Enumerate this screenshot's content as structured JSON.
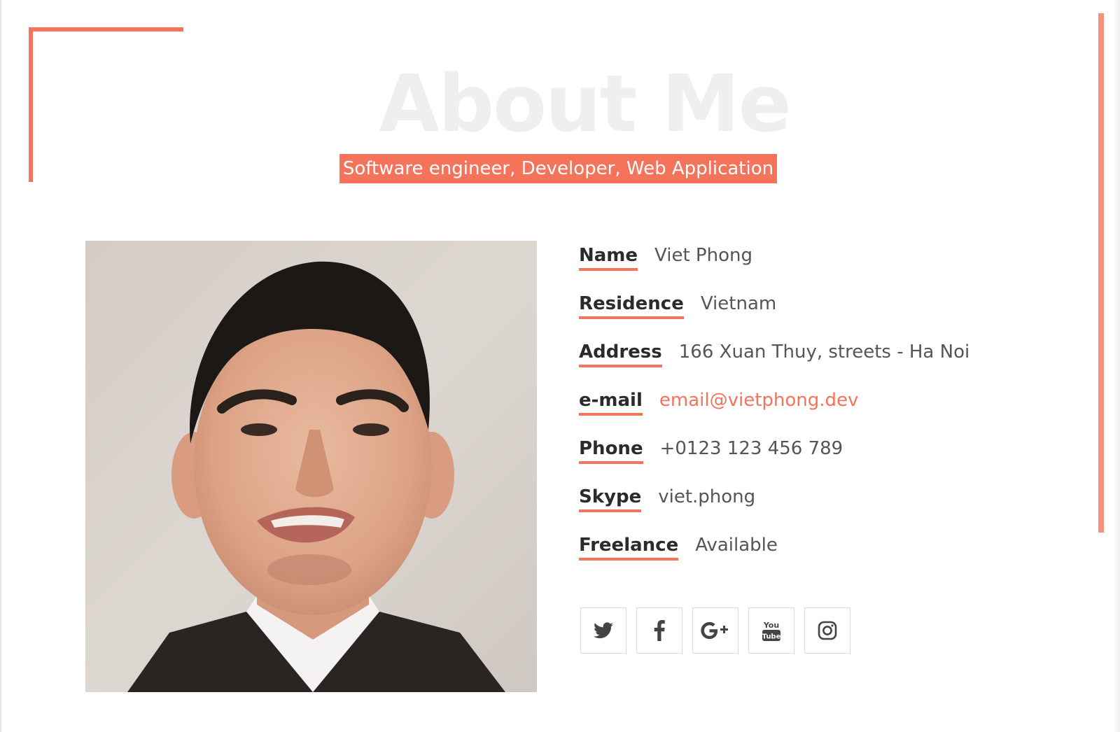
{
  "section": {
    "title": "About Me",
    "subtitle": "Software engineer, Developer, Web Application"
  },
  "profile": {
    "rows": [
      {
        "label": "Name",
        "value": "Viet Phong"
      },
      {
        "label": "Residence",
        "value": "Vietnam"
      },
      {
        "label": "Address",
        "value": "166 Xuan Thuy, streets - Ha Noi"
      },
      {
        "label": "e-mail",
        "value": "email@vietphong.dev"
      },
      {
        "label": "Phone",
        "value": "+0123 123 456 789"
      },
      {
        "label": "Skype",
        "value": "viet.phong"
      },
      {
        "label": "Freelance",
        "value": "Available"
      }
    ]
  },
  "socials": {
    "youtube_you": "You",
    "youtube_tube": "Tube",
    "items": [
      {
        "icon": "twitter-icon"
      },
      {
        "icon": "facebook-icon"
      },
      {
        "icon": "google-plus-icon"
      },
      {
        "icon": "youtube-icon"
      },
      {
        "icon": "instagram-icon"
      }
    ]
  },
  "colors": {
    "accent": "#f4735a",
    "title_watermark": "#efefef",
    "label_text": "#2b2b2b",
    "value_text": "#555555"
  }
}
